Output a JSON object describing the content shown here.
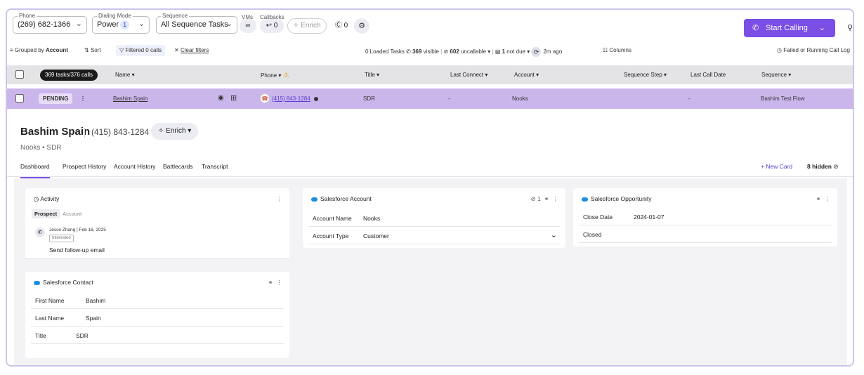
{
  "toolbar": {
    "phone_label": "Phone",
    "phone_value": "(269) 682-1366",
    "dialing_label": "Dialing Mode",
    "dialing_value": "Power",
    "dialing_badge": "1",
    "sequence_label": "Sequence",
    "sequence_value": "All Sequence Tasks",
    "vms_label": "VMs",
    "callbacks_label": "Callbacks",
    "callbacks_count": "0",
    "enrich_label": "Enrich",
    "enrich_count": "0",
    "start_calling": "Start Calling"
  },
  "filters": {
    "grouped_prefix": "Grouped by ",
    "grouped_value": "Account",
    "sort": "Sort",
    "filtered": "Filtered 0 calls",
    "clear": "Clear filters",
    "loaded": "0 Loaded Tasks",
    "visible_count": "369",
    "visible_text": "visible",
    "uncallable_count": "602",
    "uncallable_text": "uncallable",
    "notdue_count": "1",
    "notdue_text": "not due",
    "synced": "2m ago",
    "columns": "Columns",
    "failed": "Failed or Running Call Log"
  },
  "table": {
    "tasks_pill": "369 tasks/376 calls",
    "headers": {
      "name": "Name",
      "phone": "Phone",
      "title": "Title",
      "last_connect": "Last Connect",
      "account": "Account",
      "sequence_step": "Sequence Step",
      "last_call_date": "Last Call Date",
      "sequence": "Sequence"
    },
    "row": {
      "status": "PENDING",
      "name": "Bashim Spain",
      "phone": "(415) 843-1284",
      "title": "SDR",
      "last_connect": "-",
      "account": "Nooks",
      "last_call_date": "-",
      "sequence": "Bashim Test Flow"
    }
  },
  "detail": {
    "name": "Bashim Spain",
    "phone": "(415) 843-1284",
    "enrich": "Enrich",
    "subline": "Nooks • SDR",
    "tabs": [
      "Dashboard",
      "Prospect History",
      "Account History",
      "Battlecards",
      "Transcript"
    ],
    "new_card": "+ New Card",
    "hidden": "8 hidden"
  },
  "cards": {
    "activity": {
      "title": "Activity",
      "seg_on": "Prospect",
      "seg_off": "Account",
      "meta": "Jesse Zhang  |  Feb 16, 2025",
      "tag": "Interested",
      "task": "Send follow-up email"
    },
    "sf_account": {
      "title": "Salesforce Account",
      "badge": "1",
      "rows": [
        {
          "k": "Account Name",
          "v": "Nooks"
        },
        {
          "k": "Account Type",
          "v": "Customer"
        }
      ]
    },
    "sf_opportunity": {
      "title": "Salesforce Opportunity",
      "rows": [
        {
          "k": "Close Date",
          "v": "2024-01-07"
        },
        {
          "k": "Closed",
          "v": ""
        }
      ]
    },
    "sf_contact": {
      "title": "Salesforce Contact",
      "rows": [
        {
          "k": "First Name",
          "v": "Bashim"
        },
        {
          "k": "Last Name",
          "v": "Spain"
        },
        {
          "k": "Title",
          "v": "SDR"
        }
      ]
    }
  },
  "colors": {
    "accent": "#7b4ee6",
    "selected_row": "#cbb6ec",
    "salesforce": "#1c8fe0"
  }
}
